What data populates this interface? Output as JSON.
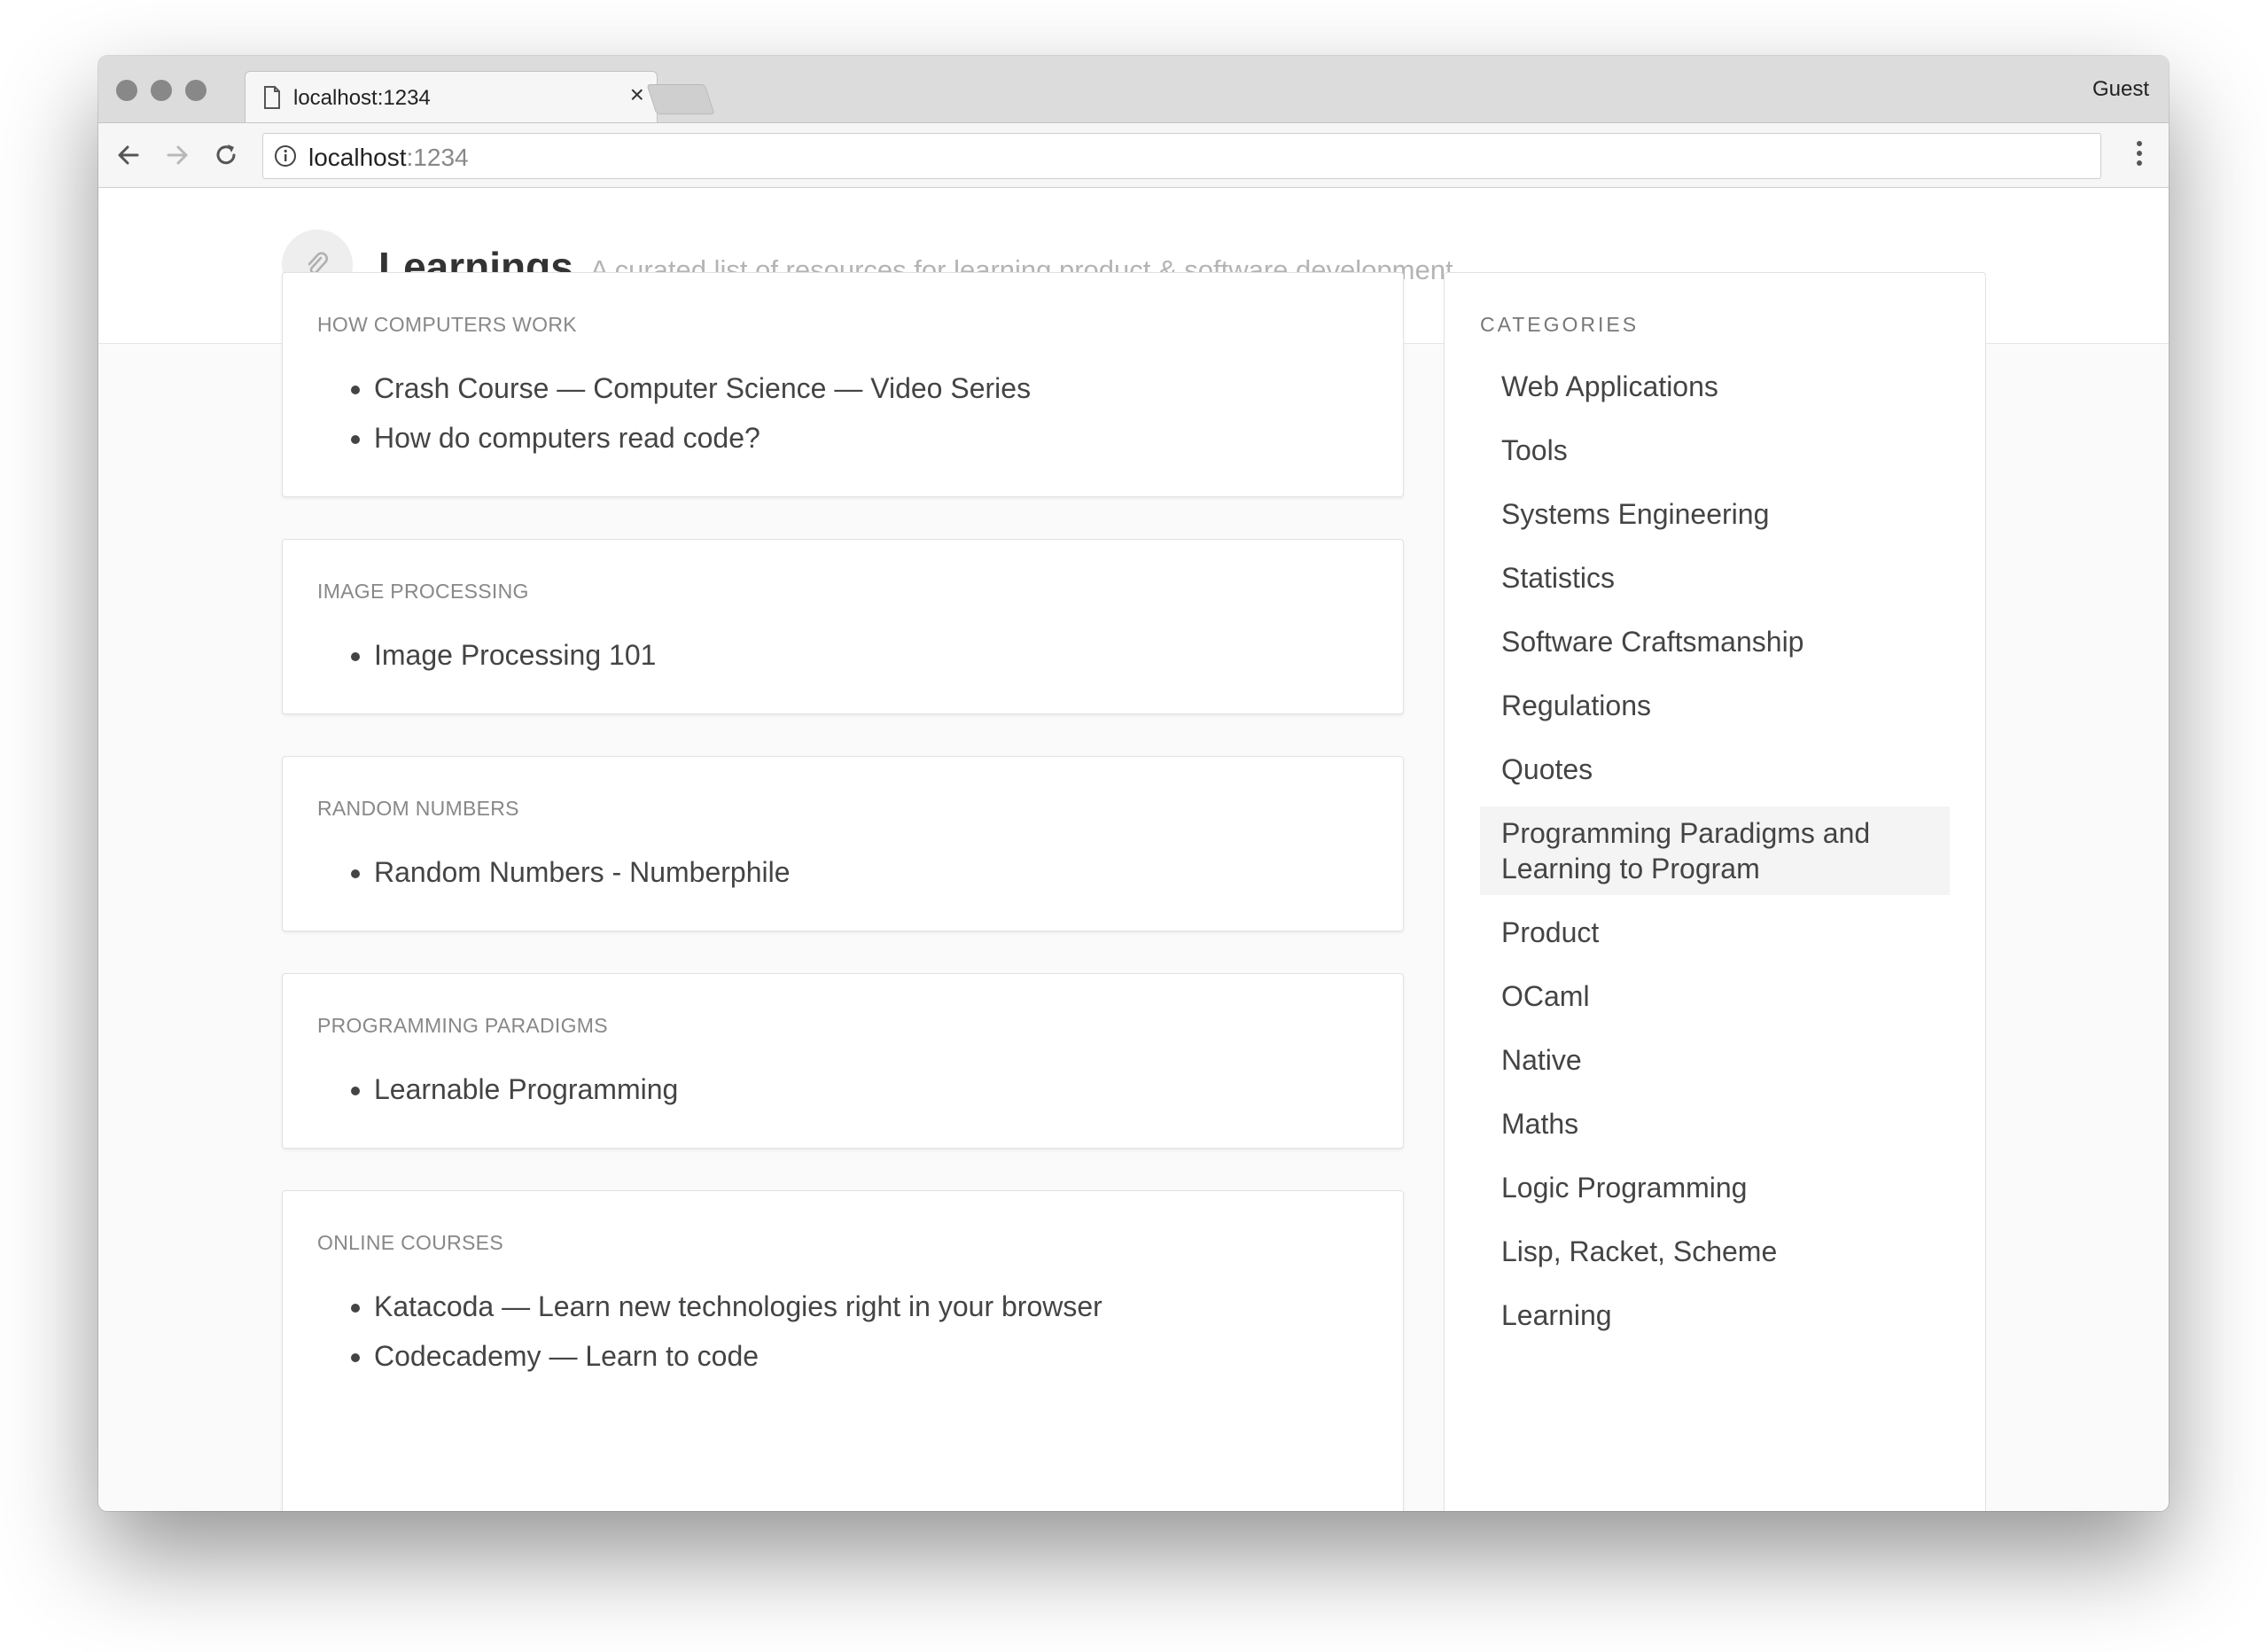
{
  "browser": {
    "tab_title": "localhost:1234",
    "tab_close": "×",
    "profile": "Guest",
    "url_host": "localhost",
    "url_port": ":1234"
  },
  "site": {
    "title": "Learnings",
    "subtitle": "A curated list of resources for learning product & software development"
  },
  "cards": [
    {
      "title": "HOW COMPUTERS WORK",
      "links": [
        "Crash Course — Computer Science — Video Series",
        "How do computers read code?"
      ]
    },
    {
      "title": "IMAGE PROCESSING",
      "links": [
        "Image Processing 101"
      ]
    },
    {
      "title": "RANDOM NUMBERS",
      "links": [
        "Random Numbers - Numberphile"
      ]
    },
    {
      "title": "PROGRAMMING PARADIGMS",
      "links": [
        "Learnable Programming"
      ]
    },
    {
      "title": "ONLINE COURSES",
      "links": [
        "Katacoda — Learn new technologies right in your browser",
        "Codecademy — Learn to code"
      ]
    }
  ],
  "sidebar": {
    "title": "CATEGORIES",
    "items": [
      "Web Applications",
      "Tools",
      "Systems Engineering",
      "Statistics",
      "Software Craftsmanship",
      "Regulations",
      "Quotes",
      "Programming Paradigms and Learning to Program",
      "Product",
      "OCaml",
      "Native",
      "Maths",
      "Logic Programming",
      "Lisp, Racket, Scheme",
      "Learning"
    ],
    "active_item": "Programming Paradigms and Learning to Program"
  },
  "colors": {
    "page_bg": "#fafafa",
    "text": "#444444",
    "muted": "#888888",
    "subtitle": "#b4b4b4",
    "active_bg": "#f4f4f4"
  }
}
